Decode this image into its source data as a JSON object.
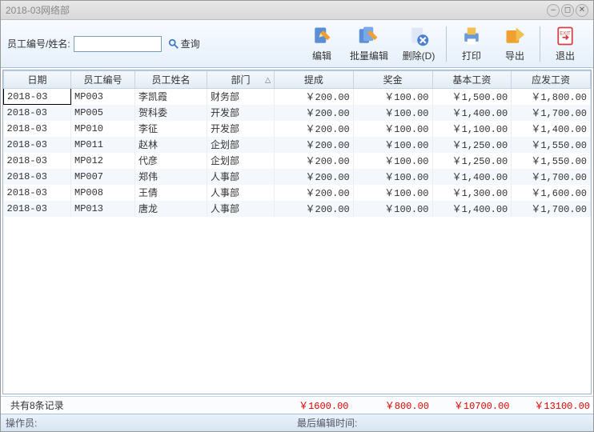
{
  "window": {
    "title": "2018-03网络部"
  },
  "search": {
    "label": "员工编号/姓名:",
    "value": "",
    "button": "查询"
  },
  "toolbar": {
    "edit": "编辑",
    "batch_edit": "批量编辑",
    "delete": "删除(D)",
    "print": "打印",
    "export": "导出",
    "exit": "退出"
  },
  "columns": {
    "date": "日期",
    "empno": "员工编号",
    "name": "员工姓名",
    "dept": "部门",
    "commission": "提成",
    "bonus": "奖金",
    "base": "基本工资",
    "payable": "应发工资"
  },
  "rows": [
    {
      "date": "2018-03",
      "empno": "MP003",
      "name": "李凯霞",
      "dept": "财务部",
      "commission": "￥200.00",
      "bonus": "￥100.00",
      "base": "￥1,500.00",
      "payable": "￥1,800.00"
    },
    {
      "date": "2018-03",
      "empno": "MP005",
      "name": "贺科委",
      "dept": "开发部",
      "commission": "￥200.00",
      "bonus": "￥100.00",
      "base": "￥1,400.00",
      "payable": "￥1,700.00"
    },
    {
      "date": "2018-03",
      "empno": "MP010",
      "name": "李征",
      "dept": "开发部",
      "commission": "￥200.00",
      "bonus": "￥100.00",
      "base": "￥1,100.00",
      "payable": "￥1,400.00"
    },
    {
      "date": "2018-03",
      "empno": "MP011",
      "name": "赵林",
      "dept": "企划部",
      "commission": "￥200.00",
      "bonus": "￥100.00",
      "base": "￥1,250.00",
      "payable": "￥1,550.00"
    },
    {
      "date": "2018-03",
      "empno": "MP012",
      "name": "代彦",
      "dept": "企划部",
      "commission": "￥200.00",
      "bonus": "￥100.00",
      "base": "￥1,250.00",
      "payable": "￥1,550.00"
    },
    {
      "date": "2018-03",
      "empno": "MP007",
      "name": "郑伟",
      "dept": "人事部",
      "commission": "￥200.00",
      "bonus": "￥100.00",
      "base": "￥1,400.00",
      "payable": "￥1,700.00"
    },
    {
      "date": "2018-03",
      "empno": "MP008",
      "name": "王倩",
      "dept": "人事部",
      "commission": "￥200.00",
      "bonus": "￥100.00",
      "base": "￥1,300.00",
      "payable": "￥1,600.00"
    },
    {
      "date": "2018-03",
      "empno": "MP013",
      "name": "唐龙",
      "dept": "人事部",
      "commission": "￥200.00",
      "bonus": "￥100.00",
      "base": "￥1,400.00",
      "payable": "￥1,700.00"
    }
  ],
  "totals": {
    "count_label": "共有8条记录",
    "commission": "￥1600.00",
    "bonus": "￥800.00",
    "base": "￥10700.00",
    "payable": "￥13100.00"
  },
  "statusbar": {
    "operator_label": "操作员:",
    "last_edit_label": "最后编辑时间:"
  }
}
